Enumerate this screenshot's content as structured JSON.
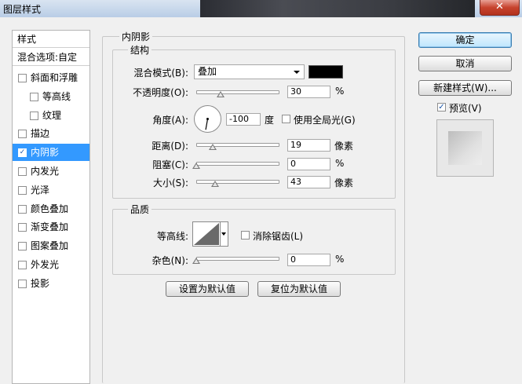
{
  "window": {
    "title": "图层样式",
    "close_label": "✕"
  },
  "sidebar": {
    "header": "样式",
    "blend_options": "混合选项:自定",
    "items": [
      {
        "label": "斜面和浮雕",
        "checked": false,
        "indent": false
      },
      {
        "label": "等高线",
        "checked": false,
        "indent": true
      },
      {
        "label": "纹理",
        "checked": false,
        "indent": true
      },
      {
        "label": "描边",
        "checked": false,
        "indent": false
      },
      {
        "label": "内阴影",
        "checked": true,
        "indent": false,
        "selected": true
      },
      {
        "label": "内发光",
        "checked": false,
        "indent": false
      },
      {
        "label": "光泽",
        "checked": false,
        "indent": false
      },
      {
        "label": "颜色叠加",
        "checked": false,
        "indent": false
      },
      {
        "label": "渐变叠加",
        "checked": false,
        "indent": false
      },
      {
        "label": "图案叠加",
        "checked": false,
        "indent": false
      },
      {
        "label": "外发光",
        "checked": false,
        "indent": false
      },
      {
        "label": "投影",
        "checked": false,
        "indent": false
      }
    ]
  },
  "inner_shadow": {
    "section_title": "内阴影",
    "structure": {
      "title": "结构",
      "blend_mode_label": "混合模式(B):",
      "blend_mode_value": "叠加",
      "color": "#000000",
      "opacity_label": "不透明度(O):",
      "opacity_value": "30",
      "opacity_unit": "%",
      "opacity_fraction": 0.3,
      "angle_label": "角度(A):",
      "angle_value": "-100",
      "angle_unit": "度",
      "global_light_label": "使用全局光(G)",
      "global_light_checked": false,
      "distance_label": "距离(D):",
      "distance_value": "19",
      "distance_unit": "像素",
      "distance_fraction": 0.2,
      "choke_label": "阻塞(C):",
      "choke_value": "0",
      "choke_unit": "%",
      "choke_fraction": 0.0,
      "size_label": "大小(S):",
      "size_value": "43",
      "size_unit": "像素",
      "size_fraction": 0.23
    },
    "quality": {
      "title": "品质",
      "contour_label": "等高线:",
      "antialias_label": "消除锯齿(L)",
      "antialias_checked": false,
      "noise_label": "杂色(N):",
      "noise_value": "0",
      "noise_unit": "%",
      "noise_fraction": 0.0
    },
    "buttons": {
      "set_default": "设置为默认值",
      "reset_default": "复位为默认值"
    }
  },
  "actions": {
    "ok": "确定",
    "cancel": "取消",
    "new_style": "新建样式(W)...",
    "preview_label": "预览(V)",
    "preview_checked": true
  }
}
